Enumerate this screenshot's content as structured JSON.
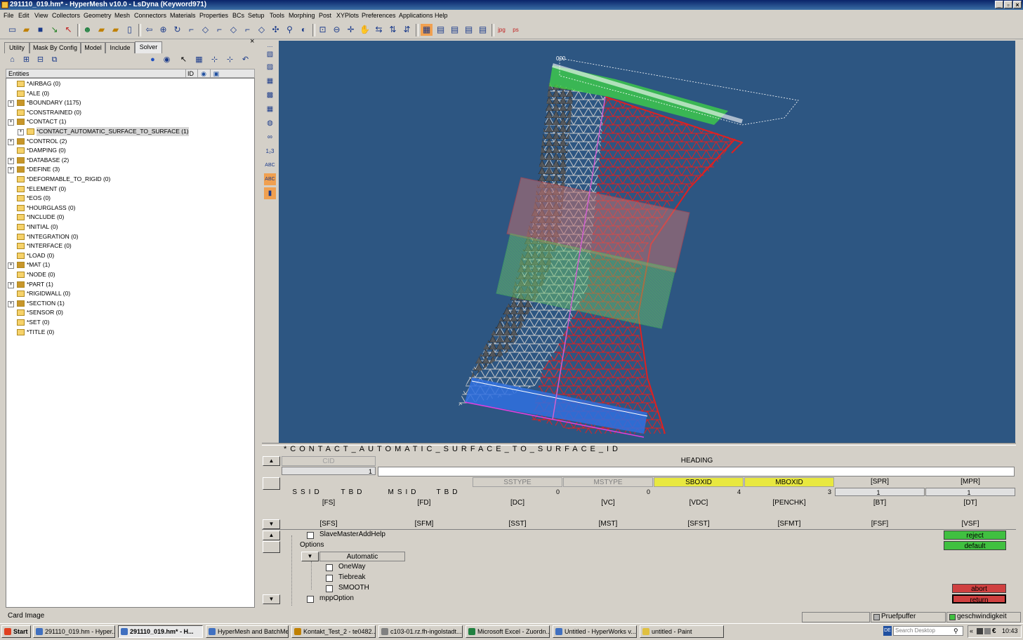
{
  "window": {
    "title": "291110_019.hm* - HyperMesh v10.0 - LsDyna (Keyword971)",
    "btn_min": "_",
    "btn_max": "▫",
    "btn_close": "×"
  },
  "menu": [
    "File",
    "Edit",
    "View",
    "Collectors",
    "Geometry",
    "Mesh",
    "Connectors",
    "Materials",
    "Properties",
    "BCs",
    "Setup",
    "Tools",
    "Morphing",
    "Post",
    "XYPlots",
    "Preferences",
    "Applications",
    "Help"
  ],
  "toolbar_icons": [
    "new-file-icon",
    "open-icon",
    "save-icon",
    "import-icon",
    "export-icon",
    "user-icon",
    "folder-open-icon",
    "folder-icon",
    "page-icon",
    "undo-arrow-icon",
    "zoom-icon",
    "rotate-icon",
    "select-icon",
    "select-icon",
    "select-icon",
    "select-icon",
    "select-icon",
    "select-icon",
    "pick-icon",
    "pick-icon",
    "zoom-box-icon",
    "zoom-out-icon",
    "pan-icon",
    "hand-icon",
    "arrows-icon",
    "arrows-icon",
    "arrows-icon",
    "view-icon",
    "view-icon",
    "view-icon",
    "view-icon",
    "view-icon",
    "jpg-icon",
    "ps-icon"
  ],
  "tabs": [
    "Utility",
    "Mask By Config",
    "Model",
    "Include",
    "Solver"
  ],
  "active_tab": "Solver",
  "tree": {
    "header_entities": "Entities",
    "header_id": "ID",
    "items": [
      {
        "label": "*AIRBAG (0)",
        "expand": false,
        "full": false
      },
      {
        "label": "*ALE (0)",
        "expand": false,
        "full": false
      },
      {
        "label": "*BOUNDARY (1175)",
        "expand": true,
        "full": true
      },
      {
        "label": "*CONSTRAINED (0)",
        "expand": false,
        "full": false
      },
      {
        "label": "*CONTACT (1)",
        "expand": true,
        "full": true
      },
      {
        "label": "*CONTACT_AUTOMATIC_SURFACE_TO_SURFACE (1)",
        "expand": true,
        "full": false,
        "child": true
      },
      {
        "label": "*CONTROL (2)",
        "expand": true,
        "full": true
      },
      {
        "label": "*DAMPING (0)",
        "expand": false,
        "full": false
      },
      {
        "label": "*DATABASE (2)",
        "expand": true,
        "full": true
      },
      {
        "label": "*DEFINE (3)",
        "expand": true,
        "full": true
      },
      {
        "label": "*DEFORMABLE_TO_RIGID (0)",
        "expand": false,
        "full": false
      },
      {
        "label": "*ELEMENT (0)",
        "expand": false,
        "full": false
      },
      {
        "label": "*EOS (0)",
        "expand": false,
        "full": false
      },
      {
        "label": "*HOURGLASS (0)",
        "expand": false,
        "full": false
      },
      {
        "label": "*INCLUDE (0)",
        "expand": false,
        "full": false
      },
      {
        "label": "*INITIAL (0)",
        "expand": false,
        "full": false
      },
      {
        "label": "*INTEGRATION (0)",
        "expand": false,
        "full": false
      },
      {
        "label": "*INTERFACE (0)",
        "expand": false,
        "full": false
      },
      {
        "label": "*LOAD (0)",
        "expand": false,
        "full": false
      },
      {
        "label": "*MAT (1)",
        "expand": true,
        "full": true
      },
      {
        "label": "*NODE (0)",
        "expand": false,
        "full": false
      },
      {
        "label": "*PART (1)",
        "expand": true,
        "full": true
      },
      {
        "label": "*RIGIDWALL (0)",
        "expand": false,
        "full": false
      },
      {
        "label": "*SECTION (1)",
        "expand": true,
        "full": true
      },
      {
        "label": "*SENSOR (0)",
        "expand": false,
        "full": false
      },
      {
        "label": "*SET (0)",
        "expand": false,
        "full": false
      },
      {
        "label": "*TITLE (0)",
        "expand": false,
        "full": false
      }
    ]
  },
  "card": {
    "title": "*CONTACT_AUTOMATIC_SURFACE_TO_SURFACE_ID",
    "row1": {
      "cid": "CID",
      "cid_val": "1",
      "heading": "HEADING"
    },
    "row2_labels": {
      "ssid": "SSID",
      "tbd1": "TBD",
      "msid": "MSID",
      "tbd2": "TBD"
    },
    "row2_headers": [
      "SSTYPE",
      "MSTYPE",
      "SBOXID",
      "MBOXID",
      "[SPR]",
      "[MPR]"
    ],
    "row2_values": [
      "0",
      "0",
      "4",
      "3",
      "1",
      "1"
    ],
    "row3": [
      "[FS]",
      "[FD]",
      "[DC]",
      "[VC]",
      "[VDC]",
      "[PENCHK]",
      "[BT]",
      "[DT]"
    ],
    "row4": [
      "[SFS]",
      "[SFM]",
      "[SST]",
      "[MST]",
      "[SFST]",
      "[SFMT]",
      "[FSF]",
      "[VSF]"
    ],
    "options": {
      "slave_help": "SlaveMasterAddHelp",
      "options_label": "Options",
      "dropdown": "Automatic",
      "oneway": "OneWay",
      "tiebreak": "Tiebreak",
      "smooth": "SMOOTH",
      "mpp": "mppOption"
    },
    "buttons": {
      "reject": "reject",
      "default": "default",
      "abort": "abort",
      "return": "return"
    }
  },
  "status": {
    "card_image": "Card Image",
    "pruefpuffer": "Pruefpuffer",
    "geschwindigkeit": "geschwindigkeit"
  },
  "taskbar": {
    "start": "Start",
    "tasks": [
      "291110_019.hm - Hyper...",
      "291110_019.hm* - H...",
      "HyperMesh and BatchMe...",
      "Kontakt_Test_2 - te0482...",
      "c103-01.rz.fh-ingolstadt....",
      "Microsoft Excel - Zuordn...",
      "Untitled - HyperWorks v...",
      "untitled - Paint"
    ],
    "search": "Search Desktop",
    "clock": "10:43"
  },
  "colors": {
    "viewport_bg": "#2d5682",
    "mesh_red": "#e02020",
    "mesh_grey": "#a0a0a0",
    "green": "#40e040",
    "box_yellow": "#e8e840",
    "btn_green": "#40c040",
    "btn_red": "#d04040"
  }
}
